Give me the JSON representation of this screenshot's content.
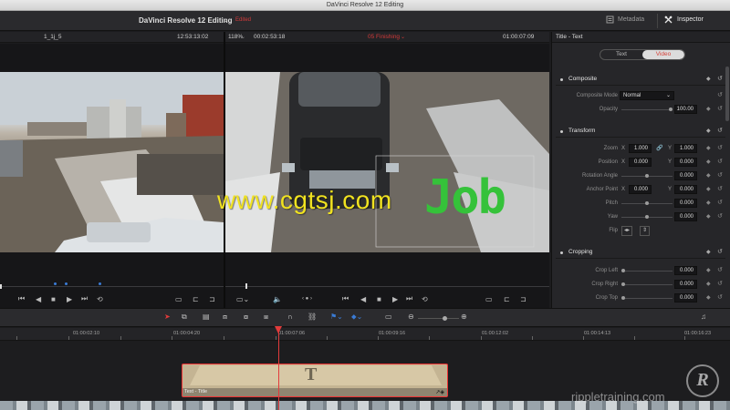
{
  "window": {
    "title": "DaVinci Resolve 12 Editing"
  },
  "header": {
    "project_name": "DaVinci Resolve 12 Editing",
    "edited_label": "Edited",
    "metadata_label": "Metadata",
    "inspector_label": "Inspector"
  },
  "source_viewer": {
    "clip_name": "1_1j_5",
    "timecode": "12:53:13:02"
  },
  "timeline_viewer": {
    "zoom": "118%",
    "duration": "00:02:53:18",
    "timeline_name": "05 Finishing",
    "timecode": "01:00:07:09"
  },
  "overlay": {
    "title_text": "Job"
  },
  "inspector": {
    "title": "Title - Text",
    "tabs": [
      {
        "label": "Text"
      },
      {
        "label": "Video"
      }
    ],
    "composite": {
      "header": "Composite",
      "mode_label": "Composite Mode",
      "mode_value": "Normal",
      "opacity_label": "Opacity",
      "opacity_value": "100.00"
    },
    "transform": {
      "header": "Transform",
      "zoom_label": "Zoom",
      "zoom_x": "1.000",
      "zoom_y": "1.000",
      "position_label": "Position",
      "position_x": "0.000",
      "position_y": "0.000",
      "rotation_label": "Rotation Angle",
      "rotation_value": "0.000",
      "anchor_label": "Anchor Point",
      "anchor_x": "0.000",
      "anchor_y": "0.000",
      "pitch_label": "Pitch",
      "pitch_value": "0.000",
      "yaw_label": "Yaw",
      "yaw_value": "0.000",
      "flip_label": "Flip",
      "x_axis": "X",
      "y_axis": "Y"
    },
    "cropping": {
      "header": "Cropping",
      "left_label": "Crop Left",
      "left_value": "0.000",
      "right_label": "Crop Right",
      "right_value": "0.000",
      "top_label": "Crop Top",
      "top_value": "0.000"
    }
  },
  "timeline": {
    "ruler": [
      "01:00:02:10",
      "01:00:04:20",
      "01:00:07:06",
      "01:00:09:16",
      "01:00:12:02",
      "01:00:14:13",
      "01:00:16:23"
    ],
    "title_clip_name": "Text - Title",
    "title_clip_glyph": "T"
  },
  "watermarks": {
    "center": "www.cgtsj.com",
    "bottom": "rippletraining.com",
    "logo": "R"
  },
  "colors": {
    "accent": "#d23a3a",
    "title_clip": "#c4b493",
    "title_overlay_green": "#35c23a",
    "watermark_yellow": "#f0e220"
  }
}
